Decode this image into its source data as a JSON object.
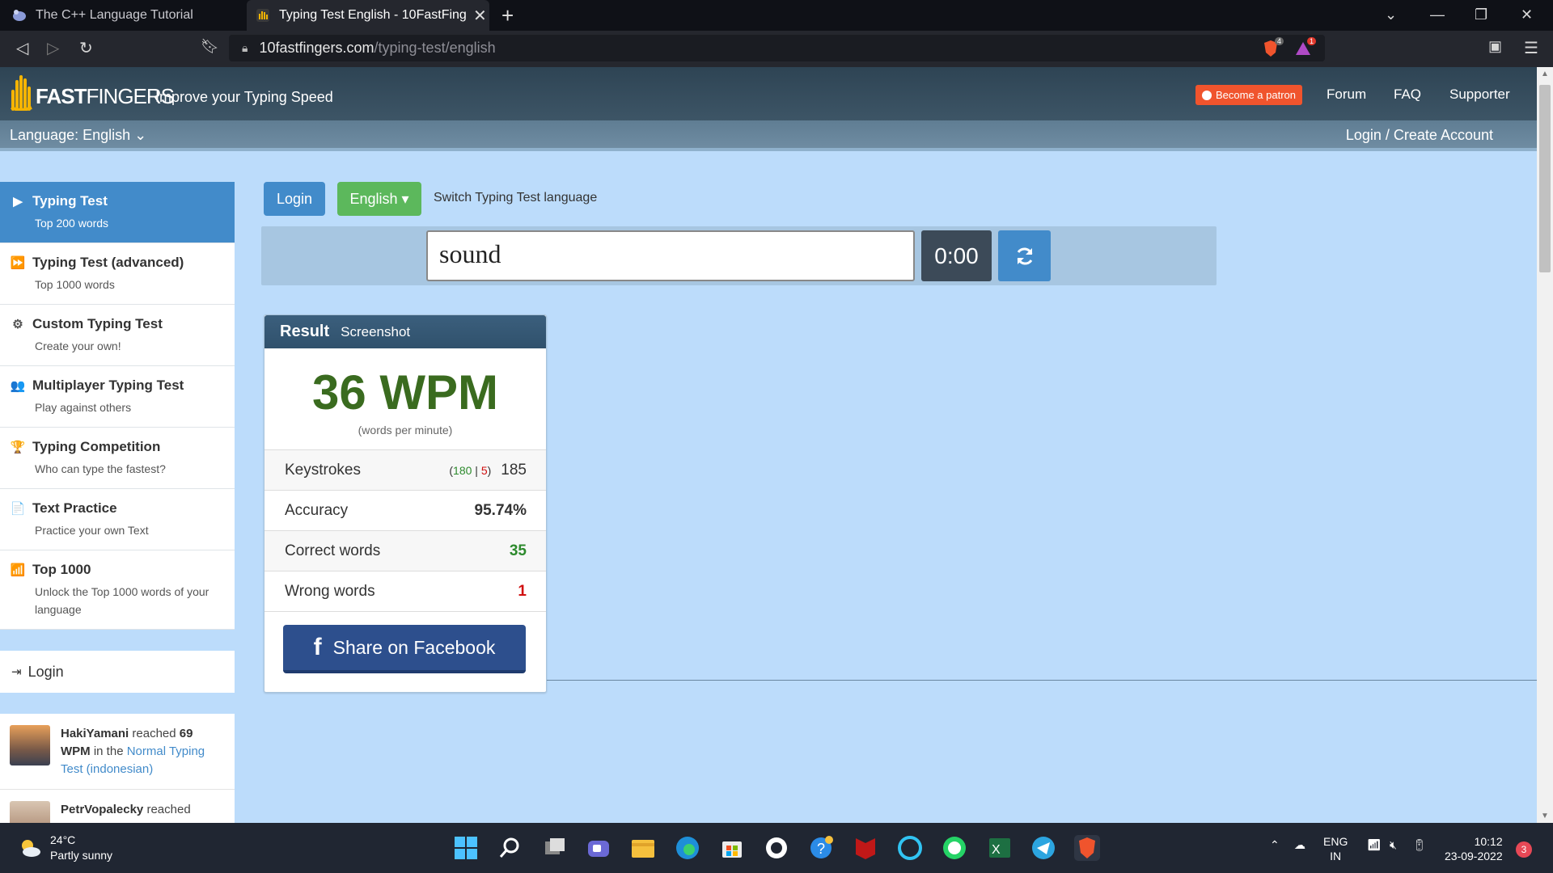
{
  "browser": {
    "tabs": [
      {
        "title": "The C++ Language Tutorial"
      },
      {
        "title": "Typing Test English - 10FastFingers",
        "close": "✕"
      }
    ],
    "new_tab": "+",
    "url_host": "10fastfingers.com",
    "url_path": "/typing-test/english",
    "brave_badge": "4",
    "rewards_badge": "1"
  },
  "site": {
    "brand_prefix": "10",
    "brand_bold": "FAST",
    "brand_rest": "FINGERS",
    "tagline": "Improve your Typing Speed",
    "patron": "Become a patron",
    "nav": [
      "Forum",
      "FAQ",
      "Supporter"
    ],
    "language": "Language: English",
    "account": "Login / Create Account"
  },
  "sidebar": {
    "items": [
      {
        "title": "Typing Test",
        "sub": "Top 200 words",
        "icon": "play-icon",
        "glyph": "▶"
      },
      {
        "title": "Typing Test (advanced)",
        "sub": "Top 1000 words",
        "icon": "fast-forward-icon",
        "glyph": "⏩"
      },
      {
        "title": "Custom Typing Test",
        "sub": "Create your own!",
        "icon": "gears-icon",
        "glyph": "⚙"
      },
      {
        "title": "Multiplayer Typing Test",
        "sub": "Play against others",
        "icon": "users-icon",
        "glyph": "👥"
      },
      {
        "title": "Typing Competition",
        "sub": "Who can type the fastest?",
        "icon": "trophy-icon",
        "glyph": "🏆"
      },
      {
        "title": "Text Practice",
        "sub": "Practice your own Text",
        "icon": "document-icon",
        "glyph": "📄"
      },
      {
        "title": "Top 1000",
        "sub": "Unlock the Top 1000 words of your language",
        "icon": "signal-icon",
        "glyph": "📶"
      }
    ],
    "login": "Login",
    "feed": [
      {
        "user": "HakiYamani",
        "pre": " reached ",
        "wpm": "69 WPM",
        "mid": " in the ",
        "link": "Normal Typing Test (indonesian)"
      },
      {
        "user": "PetrVopalecky",
        "pre": " reached",
        "wpm": "",
        "mid": "",
        "link": ""
      }
    ]
  },
  "test": {
    "login_btn": "Login",
    "lang_btn": "English ▾",
    "switch_label": "Switch Typing Test language",
    "current_word": "sound",
    "timer": "0:00"
  },
  "result": {
    "title": "Result",
    "screenshot": "Screenshot",
    "wpm": "36 WPM",
    "wpm_sub": "(words per minute)",
    "rows": {
      "keystrokes_label": "Keystrokes",
      "keystrokes_correct": "180",
      "keystrokes_sep": " | ",
      "keystrokes_wrong": "5",
      "keystrokes_open": "(",
      "keystrokes_close": ")",
      "keystrokes_total": "185",
      "accuracy_label": "Accuracy",
      "accuracy": "95.74%",
      "correct_label": "Correct words",
      "correct": "35",
      "wrong_label": "Wrong words",
      "wrong": "1"
    },
    "share": "Share on Facebook"
  },
  "taskbar": {
    "temp": "24°C",
    "weather": "Partly sunny",
    "lang1": "ENG",
    "lang2": "IN",
    "time": "10:12",
    "date": "23-09-2022",
    "notifications": "3"
  },
  "colors": {
    "accent_blue": "#428bca",
    "green_btn": "#5cb85c",
    "wpm_green": "#3a6b1f",
    "facebook": "#2d4f8d",
    "page_bg": "#bcdcfb"
  }
}
